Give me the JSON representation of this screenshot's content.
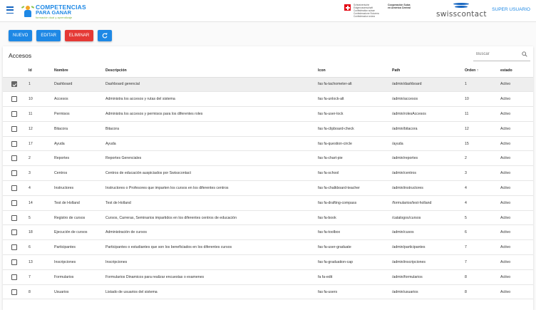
{
  "header": {
    "logo_line1": "COMPETENCIAS",
    "logo_line2": "PARA GANAR",
    "logo_tagline": "formación dual y aprendizaje",
    "swiss_text": "Schweizerische Eidgenossenschaft Confédération suisse Confederazione Svizzera Confederaziun svizra",
    "cosude_text": "Cooperación Suiza en América Central",
    "swisscontact": "swisscontact",
    "user_label": "SUPER USUARIO"
  },
  "toolbar": {
    "new_label": "NUEVO",
    "edit_label": "EDITAR",
    "delete_label": "ELIMINAR"
  },
  "card": {
    "title": "Accesos",
    "search_placeholder": "Buscar"
  },
  "table": {
    "headers": {
      "id": "Id",
      "nombre": "Nombre",
      "descripcion": "Descripción",
      "icon": "Icon",
      "path": "Path",
      "orden": "Orden ↑",
      "estado": "estado"
    },
    "rows": [
      {
        "id": "1",
        "nombre": "Dashboard",
        "descripcion": "Dashboard gerencial",
        "icon": "fas fa-tachometer-alt",
        "path": "/admin/dashboard",
        "orden": "1",
        "estado": "Activo",
        "selected": true
      },
      {
        "id": "10",
        "nombre": "Accesos",
        "descripcion": "Administra los accesos y rutas del sistema",
        "icon": "fas fa-unlock-alt",
        "path": "/admin/accesos",
        "orden": "10",
        "estado": "Activo",
        "selected": false
      },
      {
        "id": "11",
        "nombre": "Permisos",
        "descripcion": "Administra los accesos y permisos para los diferentes roles",
        "icon": "fas fa-user-lock",
        "path": "/admin/rolesAccesos",
        "orden": "11",
        "estado": "Activo",
        "selected": false
      },
      {
        "id": "12",
        "nombre": "Bitacora",
        "descripcion": "Bitacora",
        "icon": "fas fa-clipboard-check",
        "path": "/admin/bitacora",
        "orden": "12",
        "estado": "Activo",
        "selected": false
      },
      {
        "id": "17",
        "nombre": "Ayuda",
        "descripcion": "Ayuda",
        "icon": "fas fa-question-circle",
        "path": "/ayuda",
        "orden": "15",
        "estado": "Activo",
        "selected": false
      },
      {
        "id": "2",
        "nombre": "Reportes",
        "descripcion": "Reportes Gerenciales",
        "icon": "fas fa-chart-pie",
        "path": "/admin/reportes",
        "orden": "2",
        "estado": "Activo",
        "selected": false
      },
      {
        "id": "3",
        "nombre": "Centros",
        "descripcion": "Centros de educación auspiciados por Swisscontact",
        "icon": "fas fa-school",
        "path": "/admin/centros",
        "orden": "3",
        "estado": "Activo",
        "selected": false
      },
      {
        "id": "4",
        "nombre": "Instructores",
        "descripcion": "Instructores o Profesores que imparten los cursos en los diferentes centros",
        "icon": "fas fa-chalkboard-teacher",
        "path": "/admin/instructores",
        "orden": "4",
        "estado": "Activo",
        "selected": false
      },
      {
        "id": "14",
        "nombre": "Test de Holland",
        "descripcion": "Test de Holland",
        "icon": "fas fa-drafting-compass",
        "path": "/formularios/test-holland",
        "orden": "4",
        "estado": "Activo",
        "selected": false
      },
      {
        "id": "5",
        "nombre": "Registro de cursos",
        "descripcion": "Cursos, Carreras, Seminarios impartidos en los diferentes centros de educación",
        "icon": "fas fa-book",
        "path": "/catalogos/cursos",
        "orden": "5",
        "estado": "Activo",
        "selected": false
      },
      {
        "id": "18",
        "nombre": "Ejecución de cursos",
        "descripcion": "Administración de cursos",
        "icon": "fas fa-toolbox",
        "path": "/admin/cusos",
        "orden": "6",
        "estado": "Activo",
        "selected": false
      },
      {
        "id": "6",
        "nombre": "Participantes",
        "descripcion": "Participantes o estudiantes que son los beneficiados en los diferentes cursos",
        "icon": "fas fa-user-graduate",
        "path": "/admin/participantes",
        "orden": "7",
        "estado": "Activo",
        "selected": false
      },
      {
        "id": "13",
        "nombre": "Inscripciones",
        "descripcion": "Inscripciones",
        "icon": "fas fa-graduation-cap",
        "path": "/admin/inscripciones",
        "orden": "7",
        "estado": "Activo",
        "selected": false
      },
      {
        "id": "7",
        "nombre": "Formularios",
        "descripcion": "Formularios Dinamicos para realizar encuestas o examenes",
        "icon": "fa fa-edit",
        "path": "/admin/formularios",
        "orden": "8",
        "estado": "Activo",
        "selected": false
      },
      {
        "id": "8",
        "nombre": "Usuarios",
        "descripcion": "Listado de usuarios del sistema",
        "icon": "fas fa-users",
        "path": "/admin/usuarios",
        "orden": "8",
        "estado": "Activo",
        "selected": false
      }
    ]
  },
  "colors": {
    "primary": "#1e88e5",
    "danger": "#e53935",
    "selected_row": "#eeeeee"
  },
  "icons": {
    "menu": "hamburger-icon",
    "refresh": "refresh-icon",
    "search": "search-icon"
  }
}
